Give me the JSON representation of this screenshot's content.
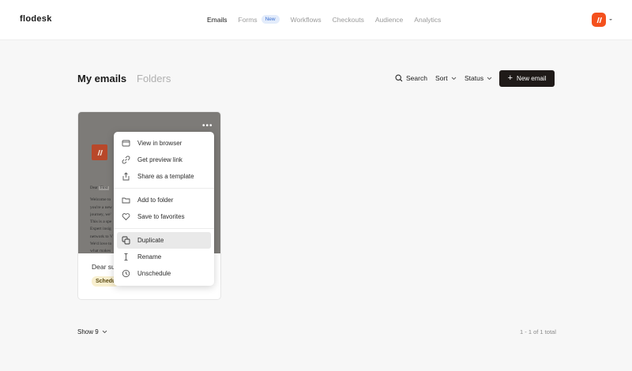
{
  "brand": "flodesk",
  "nav": {
    "items": [
      {
        "label": "Emails",
        "active": true
      },
      {
        "label": "Forms",
        "badge": "New"
      },
      {
        "label": "Workflows"
      },
      {
        "label": "Checkouts"
      },
      {
        "label": "Audience"
      },
      {
        "label": "Analytics"
      }
    ]
  },
  "header": {
    "tab_emails": "My emails",
    "tab_folders": "Folders",
    "search_label": "Search",
    "sort_label": "Sort",
    "status_label": "Status",
    "new_email_label": "New email"
  },
  "card": {
    "preview_dear": "Dear",
    "preview_first": "First",
    "preview_lines": [
      "Welcome to",
      "you're a new",
      "journey, we'",
      "This is a spe",
      "Expert insig",
      "network to V",
      "We'd love to",
      "what makes"
    ],
    "subject": "Dear sub",
    "status": "Schedu"
  },
  "menu": {
    "items": [
      {
        "label": "View in browser",
        "icon": "browser-icon"
      },
      {
        "label": "Get preview link",
        "icon": "link-icon"
      },
      {
        "label": "Share as a template",
        "icon": "share-icon"
      },
      {
        "label": "Add to folder",
        "icon": "folder-icon"
      },
      {
        "label": "Save to favorites",
        "icon": "heart-icon"
      },
      {
        "label": "Duplicate",
        "icon": "duplicate-icon",
        "highlighted": true
      },
      {
        "label": "Rename",
        "icon": "text-cursor-icon"
      },
      {
        "label": "Unschedule",
        "icon": "clock-icon"
      }
    ]
  },
  "footer": {
    "show_label": "Show 9",
    "pagination": "1 - 1 of 1 total"
  },
  "colors": {
    "accent": "#f4511e",
    "button_dark": "#1f1a18",
    "badge_bg": "#e3ecfb",
    "status_bg": "#f8efcf"
  }
}
